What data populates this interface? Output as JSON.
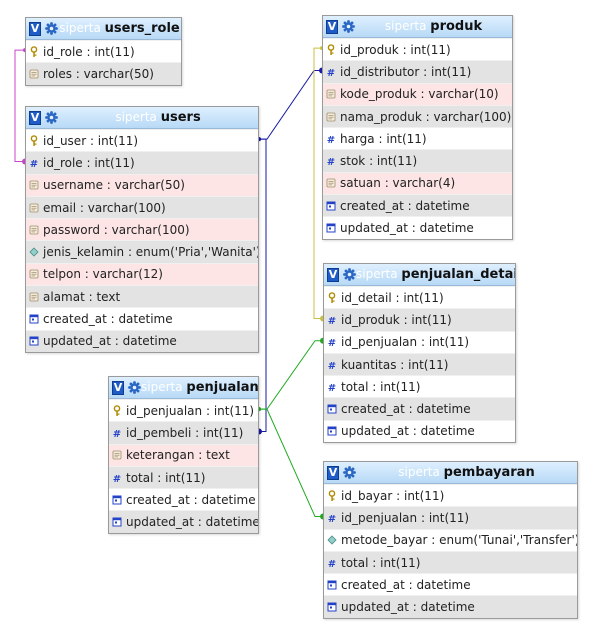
{
  "tables": [
    {
      "id": "users_role",
      "db": "siperta",
      "name": "users_role",
      "columns": [
        {
          "text": "id_role : int(11)",
          "kind": "key"
        },
        {
          "text": "roles : varchar(50)",
          "kind": "text"
        }
      ]
    },
    {
      "id": "users",
      "db": "siperta",
      "name": "users",
      "columns": [
        {
          "text": "id_user : int(11)",
          "kind": "key"
        },
        {
          "text": "id_role : int(11)",
          "kind": "num"
        },
        {
          "text": "username : varchar(50)",
          "kind": "text"
        },
        {
          "text": "email : varchar(100)",
          "kind": "text"
        },
        {
          "text": "password : varchar(100)",
          "kind": "text"
        },
        {
          "text": "jenis_kelamin : enum('Pria','Wanita')",
          "kind": "enum"
        },
        {
          "text": "telpon : varchar(12)",
          "kind": "text"
        },
        {
          "text": "alamat : text",
          "kind": "text"
        },
        {
          "text": "created_at : datetime",
          "kind": "date"
        },
        {
          "text": "updated_at : datetime",
          "kind": "date"
        }
      ]
    },
    {
      "id": "penjualan",
      "db": "siperta",
      "name": "penjualan",
      "columns": [
        {
          "text": "id_penjualan : int(11)",
          "kind": "key"
        },
        {
          "text": "id_pembeli : int(11)",
          "kind": "num"
        },
        {
          "text": "keterangan : text",
          "kind": "text"
        },
        {
          "text": "total : int(11)",
          "kind": "num"
        },
        {
          "text": "created_at : datetime",
          "kind": "date"
        },
        {
          "text": "updated_at : datetime",
          "kind": "date"
        }
      ]
    },
    {
      "id": "produk",
      "db": "siperta",
      "name": "produk",
      "columns": [
        {
          "text": "id_produk : int(11)",
          "kind": "key"
        },
        {
          "text": "id_distributor : int(11)",
          "kind": "num"
        },
        {
          "text": "kode_produk : varchar(10)",
          "kind": "text"
        },
        {
          "text": "nama_produk : varchar(100)",
          "kind": "text"
        },
        {
          "text": "harga : int(11)",
          "kind": "num"
        },
        {
          "text": "stok : int(11)",
          "kind": "num"
        },
        {
          "text": "satuan : varchar(4)",
          "kind": "text"
        },
        {
          "text": "created_at : datetime",
          "kind": "date"
        },
        {
          "text": "updated_at : datetime",
          "kind": "date"
        }
      ]
    },
    {
      "id": "penjualan_detail",
      "db": "siperta",
      "name": "penjualan_detail",
      "columns": [
        {
          "text": "id_detail : int(11)",
          "kind": "key"
        },
        {
          "text": "id_produk : int(11)",
          "kind": "num"
        },
        {
          "text": "id_penjualan : int(11)",
          "kind": "num"
        },
        {
          "text": "kuantitas : int(11)",
          "kind": "num"
        },
        {
          "text": "total : int(11)",
          "kind": "num"
        },
        {
          "text": "created_at : datetime",
          "kind": "date"
        },
        {
          "text": "updated_at : datetime",
          "kind": "date"
        }
      ]
    },
    {
      "id": "pembayaran",
      "db": "siperta",
      "name": "pembayaran",
      "columns": [
        {
          "text": "id_bayar : int(11)",
          "kind": "key"
        },
        {
          "text": "id_penjualan : int(11)",
          "kind": "num"
        },
        {
          "text": "metode_bayar : enum('Tunai','Transfer')",
          "kind": "enum"
        },
        {
          "text": "total : int(11)",
          "kind": "num"
        },
        {
          "text": "created_at : datetime",
          "kind": "date"
        },
        {
          "text": "updated_at : datetime",
          "kind": "date"
        }
      ]
    }
  ],
  "relations": [
    {
      "from": "users.id_role",
      "to": "users_role.id_role",
      "color": "#cc44cc"
    },
    {
      "from": "penjualan.id_pembeli",
      "to": "users.id_user",
      "color": "#1a1aa6"
    },
    {
      "from": "produk.id_distributor",
      "to": "users.id_user",
      "color": "#1a1aa6"
    },
    {
      "from": "penjualan_detail.id_produk",
      "to": "produk.id_produk",
      "color": "#c8c040"
    },
    {
      "from": "penjualan_detail.id_penjualan",
      "to": "penjualan.id_penjualan",
      "color": "#22aa22"
    },
    {
      "from": "pembayaran.id_penjualan",
      "to": "penjualan.id_penjualan",
      "color": "#22aa22"
    }
  ],
  "icons": {
    "toggle": "v-toggle-icon",
    "settings": "gear-icon",
    "key": "key-icon",
    "num": "hash-icon",
    "text": "text-field-icon",
    "enum": "enum-icon",
    "date": "calendar-icon"
  }
}
